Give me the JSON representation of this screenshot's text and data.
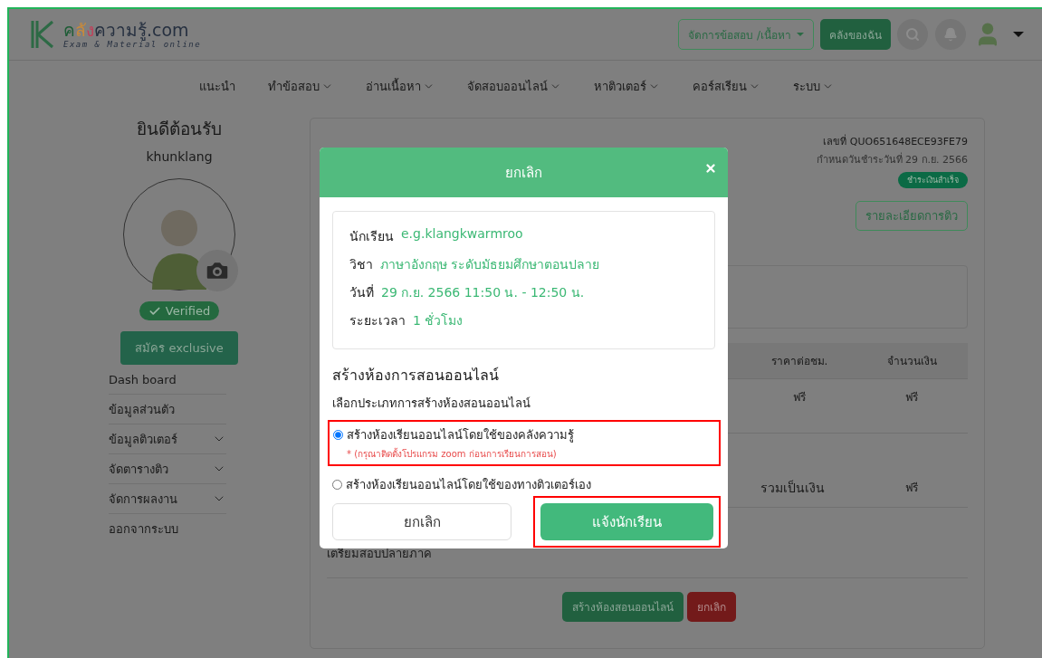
{
  "header": {
    "logo_parts": [
      {
        "text": "ค",
        "color": "#1d5c35"
      },
      {
        "text": "ลั",
        "color": "#c98a3a"
      },
      {
        "text": "ง",
        "color": "#c0405a"
      },
      {
        "text": "ความรู้.com",
        "color": "#263040"
      }
    ],
    "tagline": "Exam & Material online",
    "manage_button": "จัดการข้อสอบ /เนื้อหา",
    "library_button": "คลังของฉัน"
  },
  "nav": [
    {
      "label": "แนะนำ",
      "dropdown": false
    },
    {
      "label": "ทำข้อสอบ",
      "dropdown": true
    },
    {
      "label": "อ่านเนื้อหา",
      "dropdown": true
    },
    {
      "label": "จัดสอบออนไลน์",
      "dropdown": true
    },
    {
      "label": "หาติวเตอร์",
      "dropdown": true
    },
    {
      "label": "คอร์สเรียน",
      "dropdown": true
    },
    {
      "label": "ระบบ",
      "dropdown": true
    }
  ],
  "sidebar": {
    "welcome": "ยินดีต้อนรับ",
    "username": "khunklang",
    "verified": "Verified",
    "exclusive_button": "สมัคร exclusive",
    "menu": [
      {
        "label": "Dash board",
        "expandable": false
      },
      {
        "label": "ข้อมูลส่วนตัว",
        "expandable": false
      },
      {
        "label": "ข้อมูลติวเตอร์",
        "expandable": true
      },
      {
        "label": "จัดตารางติว",
        "expandable": true
      },
      {
        "label": "จัดการผลงาน",
        "expandable": true
      },
      {
        "label": "ออกจากระบบ",
        "expandable": false
      }
    ]
  },
  "invoice": {
    "number": "เลขที่ QUO651648ECE93FE79",
    "due": "กำหนดวันชำระวันที่ 29 ก.ย. 2566",
    "status": "ชำระเงินสำเร็จ",
    "detail_button": "รายละเอียดการติว",
    "columns": [
      "ราคาต่อชม.",
      "จำนวนเงิน"
    ],
    "rows": [
      [
        "ฟรี",
        "ฟรี"
      ]
    ],
    "total_label": "รวมเป็นเงิน",
    "total_value": "ฟรี",
    "note": "เตรียมสอบปลายภาค",
    "create_button": "สร้างห้องสอนออนไลน์",
    "cancel_button": "ยกเลิก"
  },
  "modal": {
    "title": "ยกเลิก",
    "details": [
      {
        "label": "นักเรียน",
        "value": "e.g.klangkwarmroo"
      },
      {
        "label": "วิชา",
        "value": "ภาษาอังกฤษ ระดับมัธยมศึกษาตอนปลาย"
      },
      {
        "label": "วันที่",
        "value": "29 ก.ย. 2566 11:50 น. - 12:50 น."
      },
      {
        "label": "ระยะเวลา",
        "value": "1 ชั่วโมง"
      }
    ],
    "section_title": "สร้างห้องการสอนออนไลน์",
    "prompt": "เลือกประเภทการสร้างห้องสอนออนไลน์",
    "options": [
      {
        "label": "สร้างห้องเรียนออนไลน์โดยใช้ของคลังความรู้",
        "note": "* (กรุณาติดตั้งโปรแกรม zoom ก่อนการเรียนการสอน)",
        "selected": true
      },
      {
        "label": "สร้างห้องเรียนออนไลน์โดยใช้ของทางติวเตอร์เอง",
        "selected": false
      }
    ],
    "cancel_button": "ยกเลิก",
    "confirm_button": "แจ้งนักเรียน"
  }
}
